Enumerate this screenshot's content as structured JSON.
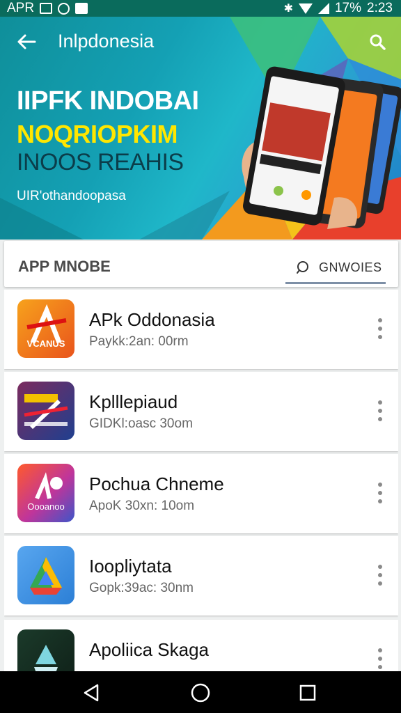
{
  "status_bar": {
    "carrier": "APR",
    "battery": "17%",
    "time": "2:23",
    "icons": [
      "image-icon",
      "circle-icon",
      "download-icon",
      "bluetooth-icon",
      "wifi-icon",
      "signal-icon"
    ]
  },
  "app_bar": {
    "title": "Inlpdonesia",
    "back_icon": "arrow-left-icon",
    "search_icon": "search-icon"
  },
  "hero": {
    "line1": "IIPFK INDOBAI",
    "line2": "NOQRIOPKIM",
    "line3": "INOOS REAHIS",
    "subtitle": "UIR'othandoopasa"
  },
  "section": {
    "title": "APP MNOBE",
    "tab_label": "GNWOIES",
    "tab_icon": "search-icon"
  },
  "apps": [
    {
      "name": "APk Oddonasia",
      "meta": "Paykk:2an: 00rm",
      "icon_text": "VCANUS"
    },
    {
      "name": "Kplllepiaud",
      "meta": "GIDKl:oasc 30om",
      "icon_text": ""
    },
    {
      "name": "Pochua Chneme",
      "meta": "ApoK 30xn: 10om",
      "icon_text": "Oooanoo"
    },
    {
      "name": "Ioopliytata",
      "meta": "Gopk:39ac: 30nm",
      "icon_text": ""
    },
    {
      "name": "Apoliica Skaga",
      "meta": "",
      "icon_text": ""
    }
  ],
  "colors": {
    "status_bar": "#0a6b5c",
    "accent_yellow": "#ffe600",
    "tab_underline": "#7d8fa6"
  },
  "nav_bar": {
    "icons": [
      "back-triangle-icon",
      "home-circle-icon",
      "recents-square-icon"
    ]
  }
}
